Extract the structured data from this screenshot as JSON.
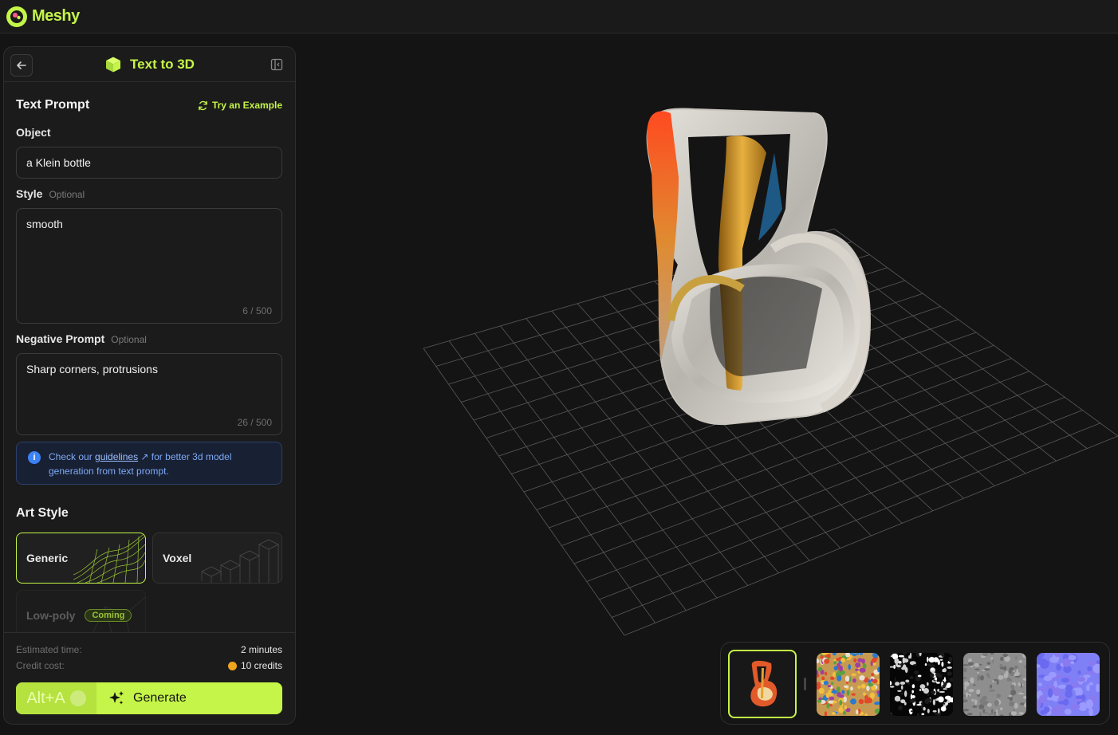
{
  "app": {
    "name": "Meshy"
  },
  "panel": {
    "title": "Text to 3D",
    "text_prompt": {
      "title": "Text Prompt",
      "try_example": "Try an Example",
      "object_label": "Object",
      "object_value": "a Klein bottle",
      "style_label": "Style",
      "style_optional": "Optional",
      "style_value": "smooth",
      "style_counter": "6 / 500",
      "negative_label": "Negative Prompt",
      "negative_optional": "Optional",
      "negative_value": "Sharp corners, protrusions",
      "negative_counter": "26 / 500"
    },
    "info": {
      "prefix": "Check our ",
      "link": "guidelines",
      "suffix": " for better 3d model generation from text prompt."
    },
    "art_style": {
      "title": "Art Style",
      "options": [
        {
          "label": "Generic",
          "selected": true
        },
        {
          "label": "Voxel",
          "selected": false
        },
        {
          "label": "Low-poly",
          "badge": "Coming",
          "disabled": true
        }
      ]
    },
    "footer": {
      "time_label": "Estimated time:",
      "time_value": "2 minutes",
      "credit_label": "Credit cost:",
      "credit_value": "10 credits",
      "shortcut": "Alt+A",
      "generate_label": "Generate"
    }
  },
  "viewer": {
    "thumbnails": [
      "model-preview",
      "base-color-texture",
      "metallic-texture",
      "roughness-texture",
      "normal-map-texture"
    ]
  },
  "colors": {
    "accent": "#c5f548",
    "background": "#141414",
    "panel": "#1b1b1b",
    "info": "#3b82f6"
  }
}
